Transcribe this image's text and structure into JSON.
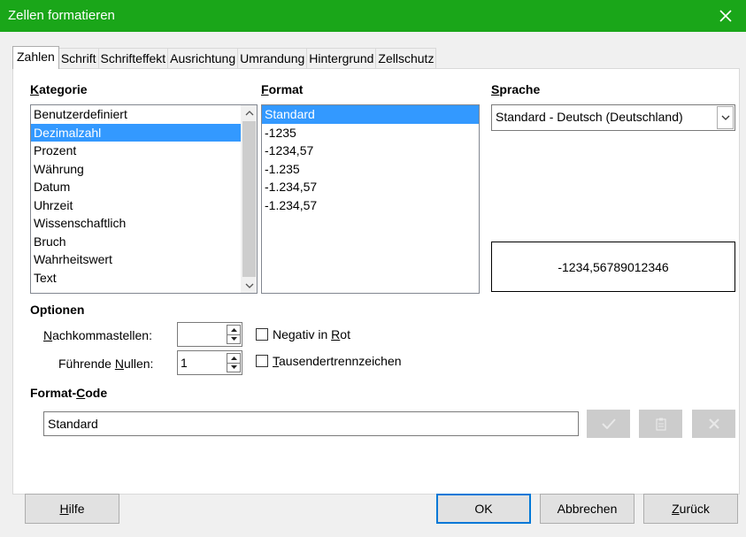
{
  "window": {
    "title": "Zellen formatieren",
    "close_icon": "close-icon"
  },
  "tabs": [
    {
      "label": "Zahlen",
      "active": true
    },
    {
      "label": "Schrift",
      "active": false
    },
    {
      "label": "Schrifteffekt",
      "active": false
    },
    {
      "label": "Ausrichtung",
      "active": false
    },
    {
      "label": "Umrandung",
      "active": false
    },
    {
      "label": "Hintergrund",
      "active": false
    },
    {
      "label": "Zellschutz",
      "active": false
    }
  ],
  "kategorie": {
    "heading_pre": "",
    "heading_u": "K",
    "heading_post": "ategorie",
    "items": [
      "Benutzerdefiniert",
      "Dezimalzahl",
      "Prozent",
      "Währung",
      "Datum",
      "Uhrzeit",
      "Wissenschaftlich",
      "Bruch",
      "Wahrheitswert",
      "Text"
    ],
    "selected": "Dezimalzahl"
  },
  "format": {
    "heading_pre": "",
    "heading_u": "F",
    "heading_post": "ormat",
    "items": [
      "Standard",
      "-1235",
      "-1234,57",
      "-1.235",
      "-1.234,57",
      "-1.234,57"
    ],
    "selected": "Standard"
  },
  "sprache": {
    "heading_pre": "",
    "heading_u": "S",
    "heading_post": "prache",
    "value": "Standard - Deutsch (Deutschland)"
  },
  "preview": {
    "text": "-1234,56789012346"
  },
  "optionen": {
    "heading": "Optionen",
    "nachkommastellen": {
      "label_pre": "",
      "label_u": "N",
      "label_post": "achkommastellen:",
      "value": ""
    },
    "fuehrende_nullen": {
      "label_pre": "Führende ",
      "label_u": "N",
      "label_post": "ullen:",
      "value": "1"
    },
    "negativ_rot": {
      "label_pre": "Negativ in ",
      "label_u": "R",
      "label_post": "ot",
      "checked": false
    },
    "tausender": {
      "label_pre": "",
      "label_u": "T",
      "label_post": "ausendertrennzeichen",
      "checked": false
    }
  },
  "format_code": {
    "heading_pre": "Format-",
    "heading_u": "C",
    "heading_post": "ode",
    "value": "Standard"
  },
  "buttons": {
    "hilfe_pre": "",
    "hilfe_u": "H",
    "hilfe_post": "ilfe",
    "ok": "OK",
    "abbrechen": "Abbrechen",
    "zurueck_pre": "",
    "zurueck_u": "Z",
    "zurueck_post": "urück"
  },
  "colors": {
    "titlebar": "#1aa619",
    "selection": "#3399ff",
    "default_button_border": "#0078d7"
  }
}
